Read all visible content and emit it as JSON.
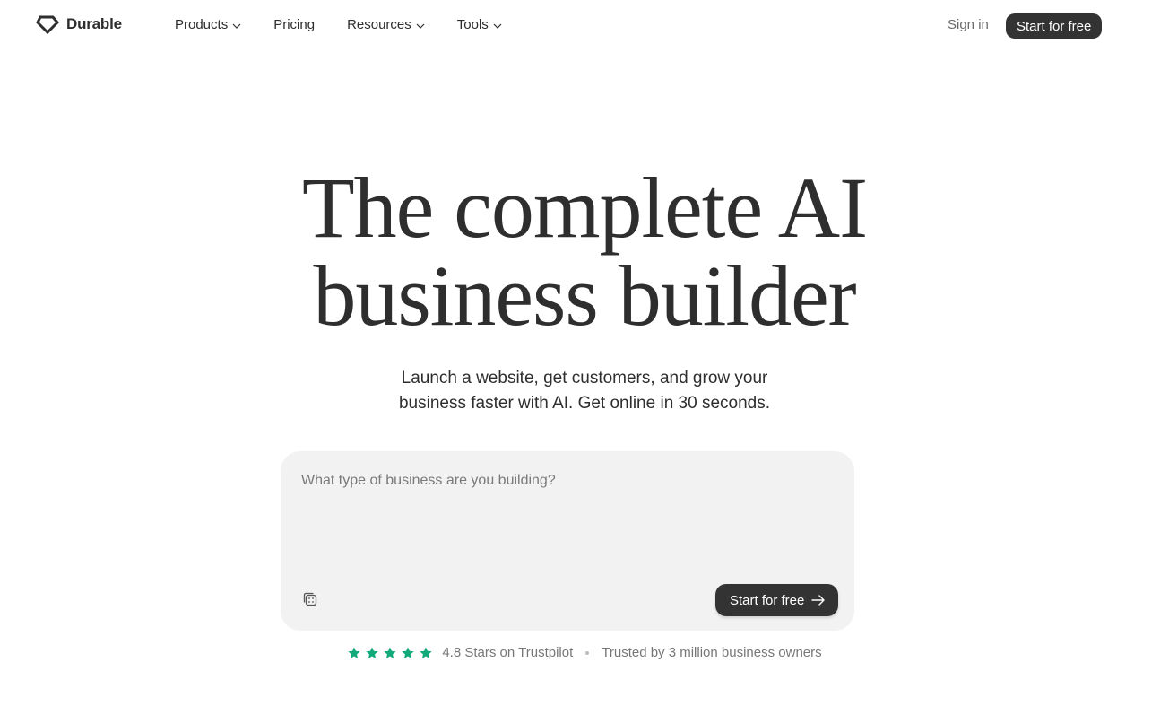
{
  "nav": {
    "brand": "Durable",
    "items": [
      {
        "label": "Products",
        "has_dropdown": true
      },
      {
        "label": "Pricing",
        "has_dropdown": false
      },
      {
        "label": "Resources",
        "has_dropdown": true
      },
      {
        "label": "Tools",
        "has_dropdown": true
      }
    ],
    "sign_in": "Sign in",
    "cta": "Start for free"
  },
  "hero": {
    "headline_line1": "The complete AI",
    "headline_line2": "business builder",
    "sub_line1": "Launch a website, get customers, and grow your",
    "sub_line2": "business faster with AI. Get online in 30 seconds."
  },
  "prompt": {
    "placeholder": "What type of business are you building?",
    "value": "",
    "cta": "Start for free",
    "random_icon": "dice-icon",
    "cta_icon": "arrow-right-icon"
  },
  "proof": {
    "stars": 5,
    "rating_text": "4.8 Stars on Trustpilot",
    "trust_text": "Trusted by 3 million business owners"
  },
  "colors": {
    "text": "#2e2e2e",
    "button_bg": "#333333",
    "prompt_bg": "#f2f2f2",
    "star": "#11a97a",
    "muted": "#777777"
  }
}
